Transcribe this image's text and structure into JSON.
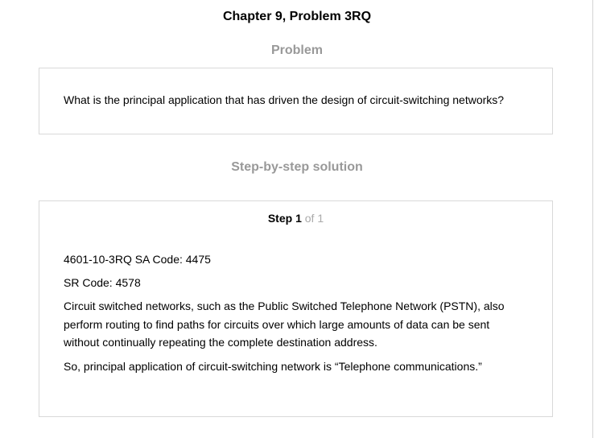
{
  "header": {
    "title": "Chapter 9, Problem 3RQ"
  },
  "problem": {
    "heading": "Problem",
    "text": "What is the principal application that has driven the design of circuit-switching networks?"
  },
  "solution": {
    "heading": "Step-by-step solution",
    "step": {
      "word": "Step",
      "number": "1",
      "of_text": "of",
      "total": "1"
    },
    "lines": [
      "4601-10-3RQ SA Code: 4475",
      "SR Code: 4578",
      "Circuit switched networks, such as the Public Switched Telephone Network (PSTN), also perform routing to find paths for circuits over which large amounts of data can be sent without continually repeating the complete destination address.",
      "So, principal application of circuit-switching network is “Telephone communications.”"
    ]
  }
}
